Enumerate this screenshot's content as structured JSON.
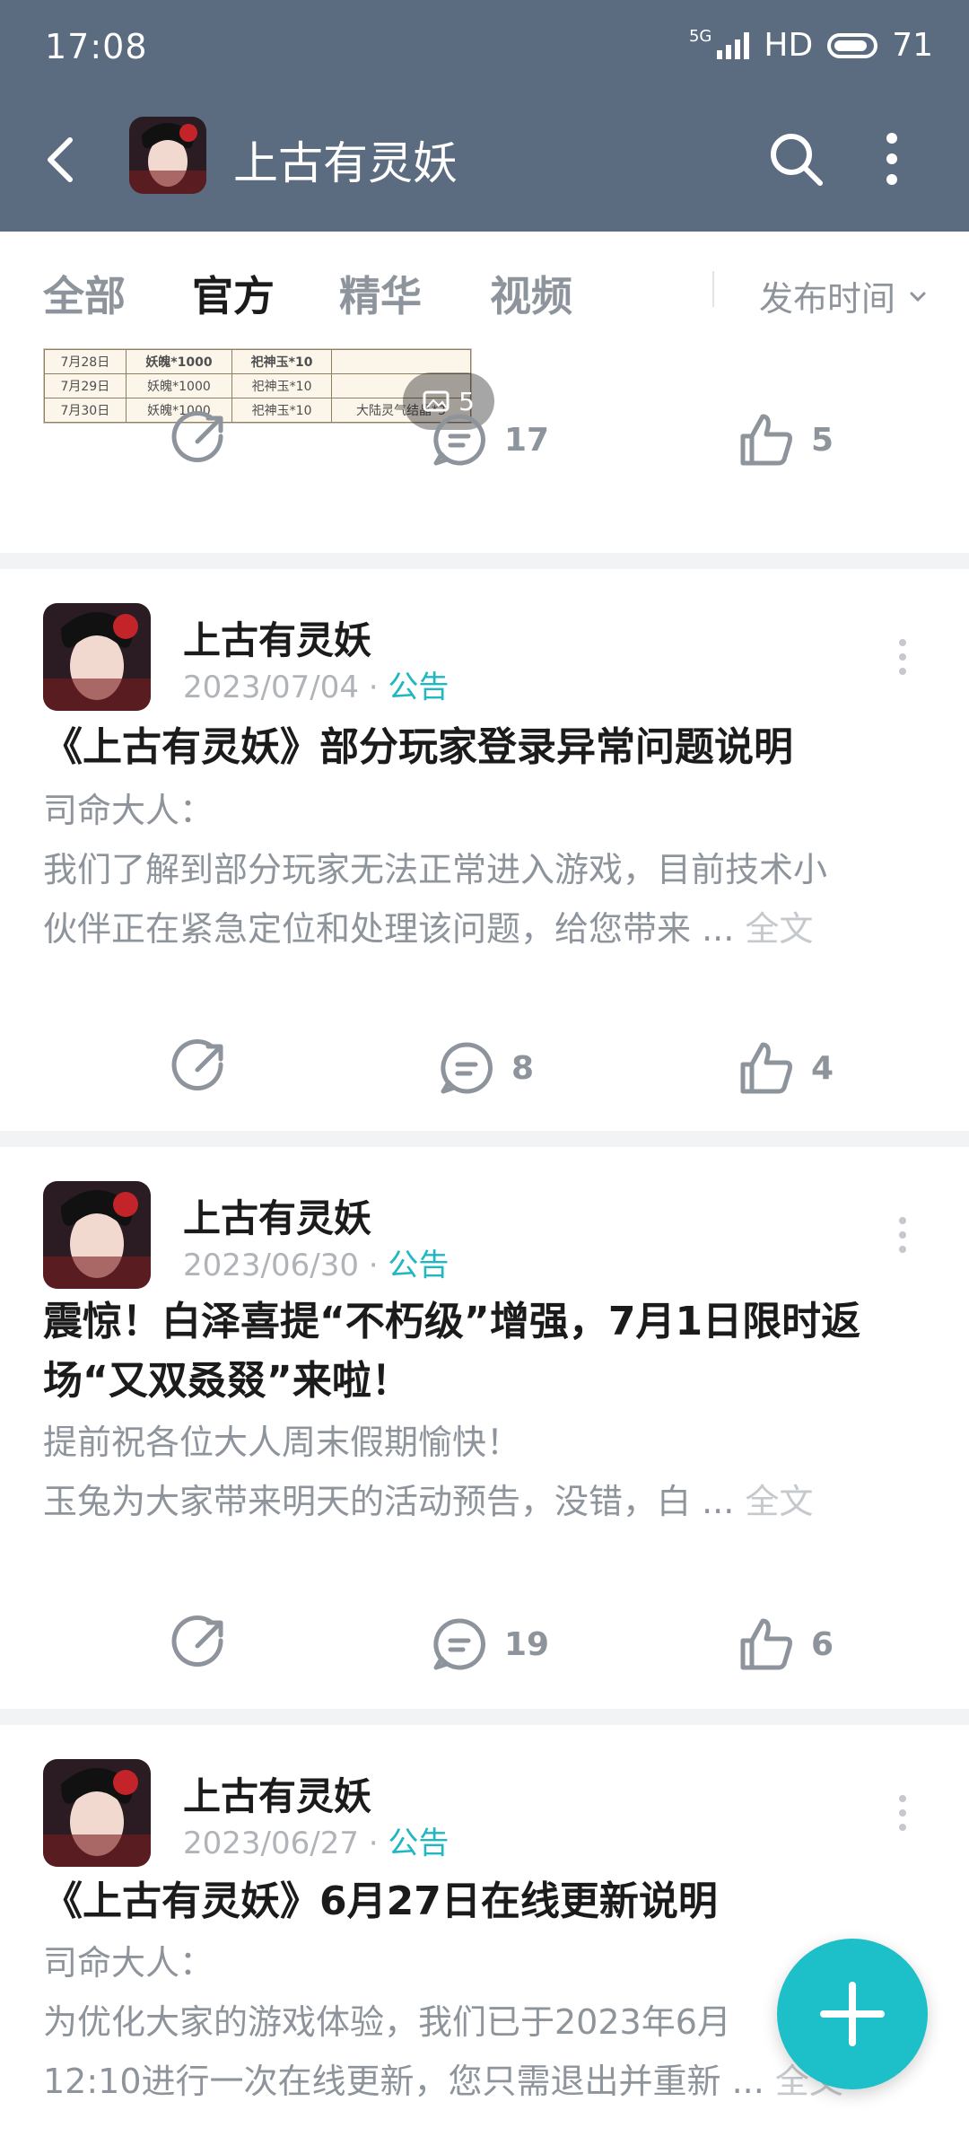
{
  "status_bar": {
    "time": "17:08",
    "network": "5G",
    "hd": "HD",
    "battery": "71"
  },
  "nav": {
    "title": "上古有灵妖"
  },
  "tabs": [
    {
      "label": "全部"
    },
    {
      "label": "官方"
    },
    {
      "label": "精华"
    },
    {
      "label": "视频"
    }
  ],
  "sort": {
    "label": "发布时间"
  },
  "first_card": {
    "thumbnail_rows": [
      [
        "7月28日",
        "妖魄*1000",
        "祀神玉*10",
        ""
      ],
      [
        "7月29日",
        "妖魄*1000",
        "祀神玉*10",
        ""
      ],
      [
        "7月30日",
        "妖魄*1000",
        "祀神玉*10",
        "大陆灵气结晶*3"
      ]
    ],
    "image_count": "5",
    "comments": "17",
    "likes": "5"
  },
  "posts": [
    {
      "author": "上古有灵妖",
      "date": "2023/07/04",
      "type": "公告",
      "title": "《上古有灵妖》部分玩家登录异常问题说明",
      "body_line1": "司命大人：",
      "body_line2": "我们了解到部分玩家无法正常进入游戏，目前技术小",
      "body_line3": "伙伴正在紧急定位和处理该问题，给您带来 ... ",
      "fulltext": "全文",
      "comments": "8",
      "likes": "4"
    },
    {
      "author": "上古有灵妖",
      "date": "2023/06/30",
      "type": "公告",
      "title_line1": "震惊！白泽喜提“不朽级”增强，7月1日限时返",
      "title_line2": "场“又双叒叕”来啦！",
      "body_line1": "提前祝各位大人周末假期愉快！",
      "body_line2": "玉兔为大家带来明天的活动预告，没错，白 ... ",
      "fulltext": "全文",
      "comments": "19",
      "likes": "6"
    },
    {
      "author": "上古有灵妖",
      "date": "2023/06/27",
      "type": "公告",
      "title": "《上古有灵妖》6月27日在线更新说明",
      "body_line1": "司命大人：",
      "body_line2": "为优化大家的游戏体验，我们已于2023年6月",
      "body_line3": "12:10进行一次在线更新，您只需退出并重新 ... ",
      "fulltext": "全文"
    }
  ],
  "colors": {
    "header": "#5b6b80",
    "accent": "#1fc0c8",
    "muted": "#8e949b"
  }
}
